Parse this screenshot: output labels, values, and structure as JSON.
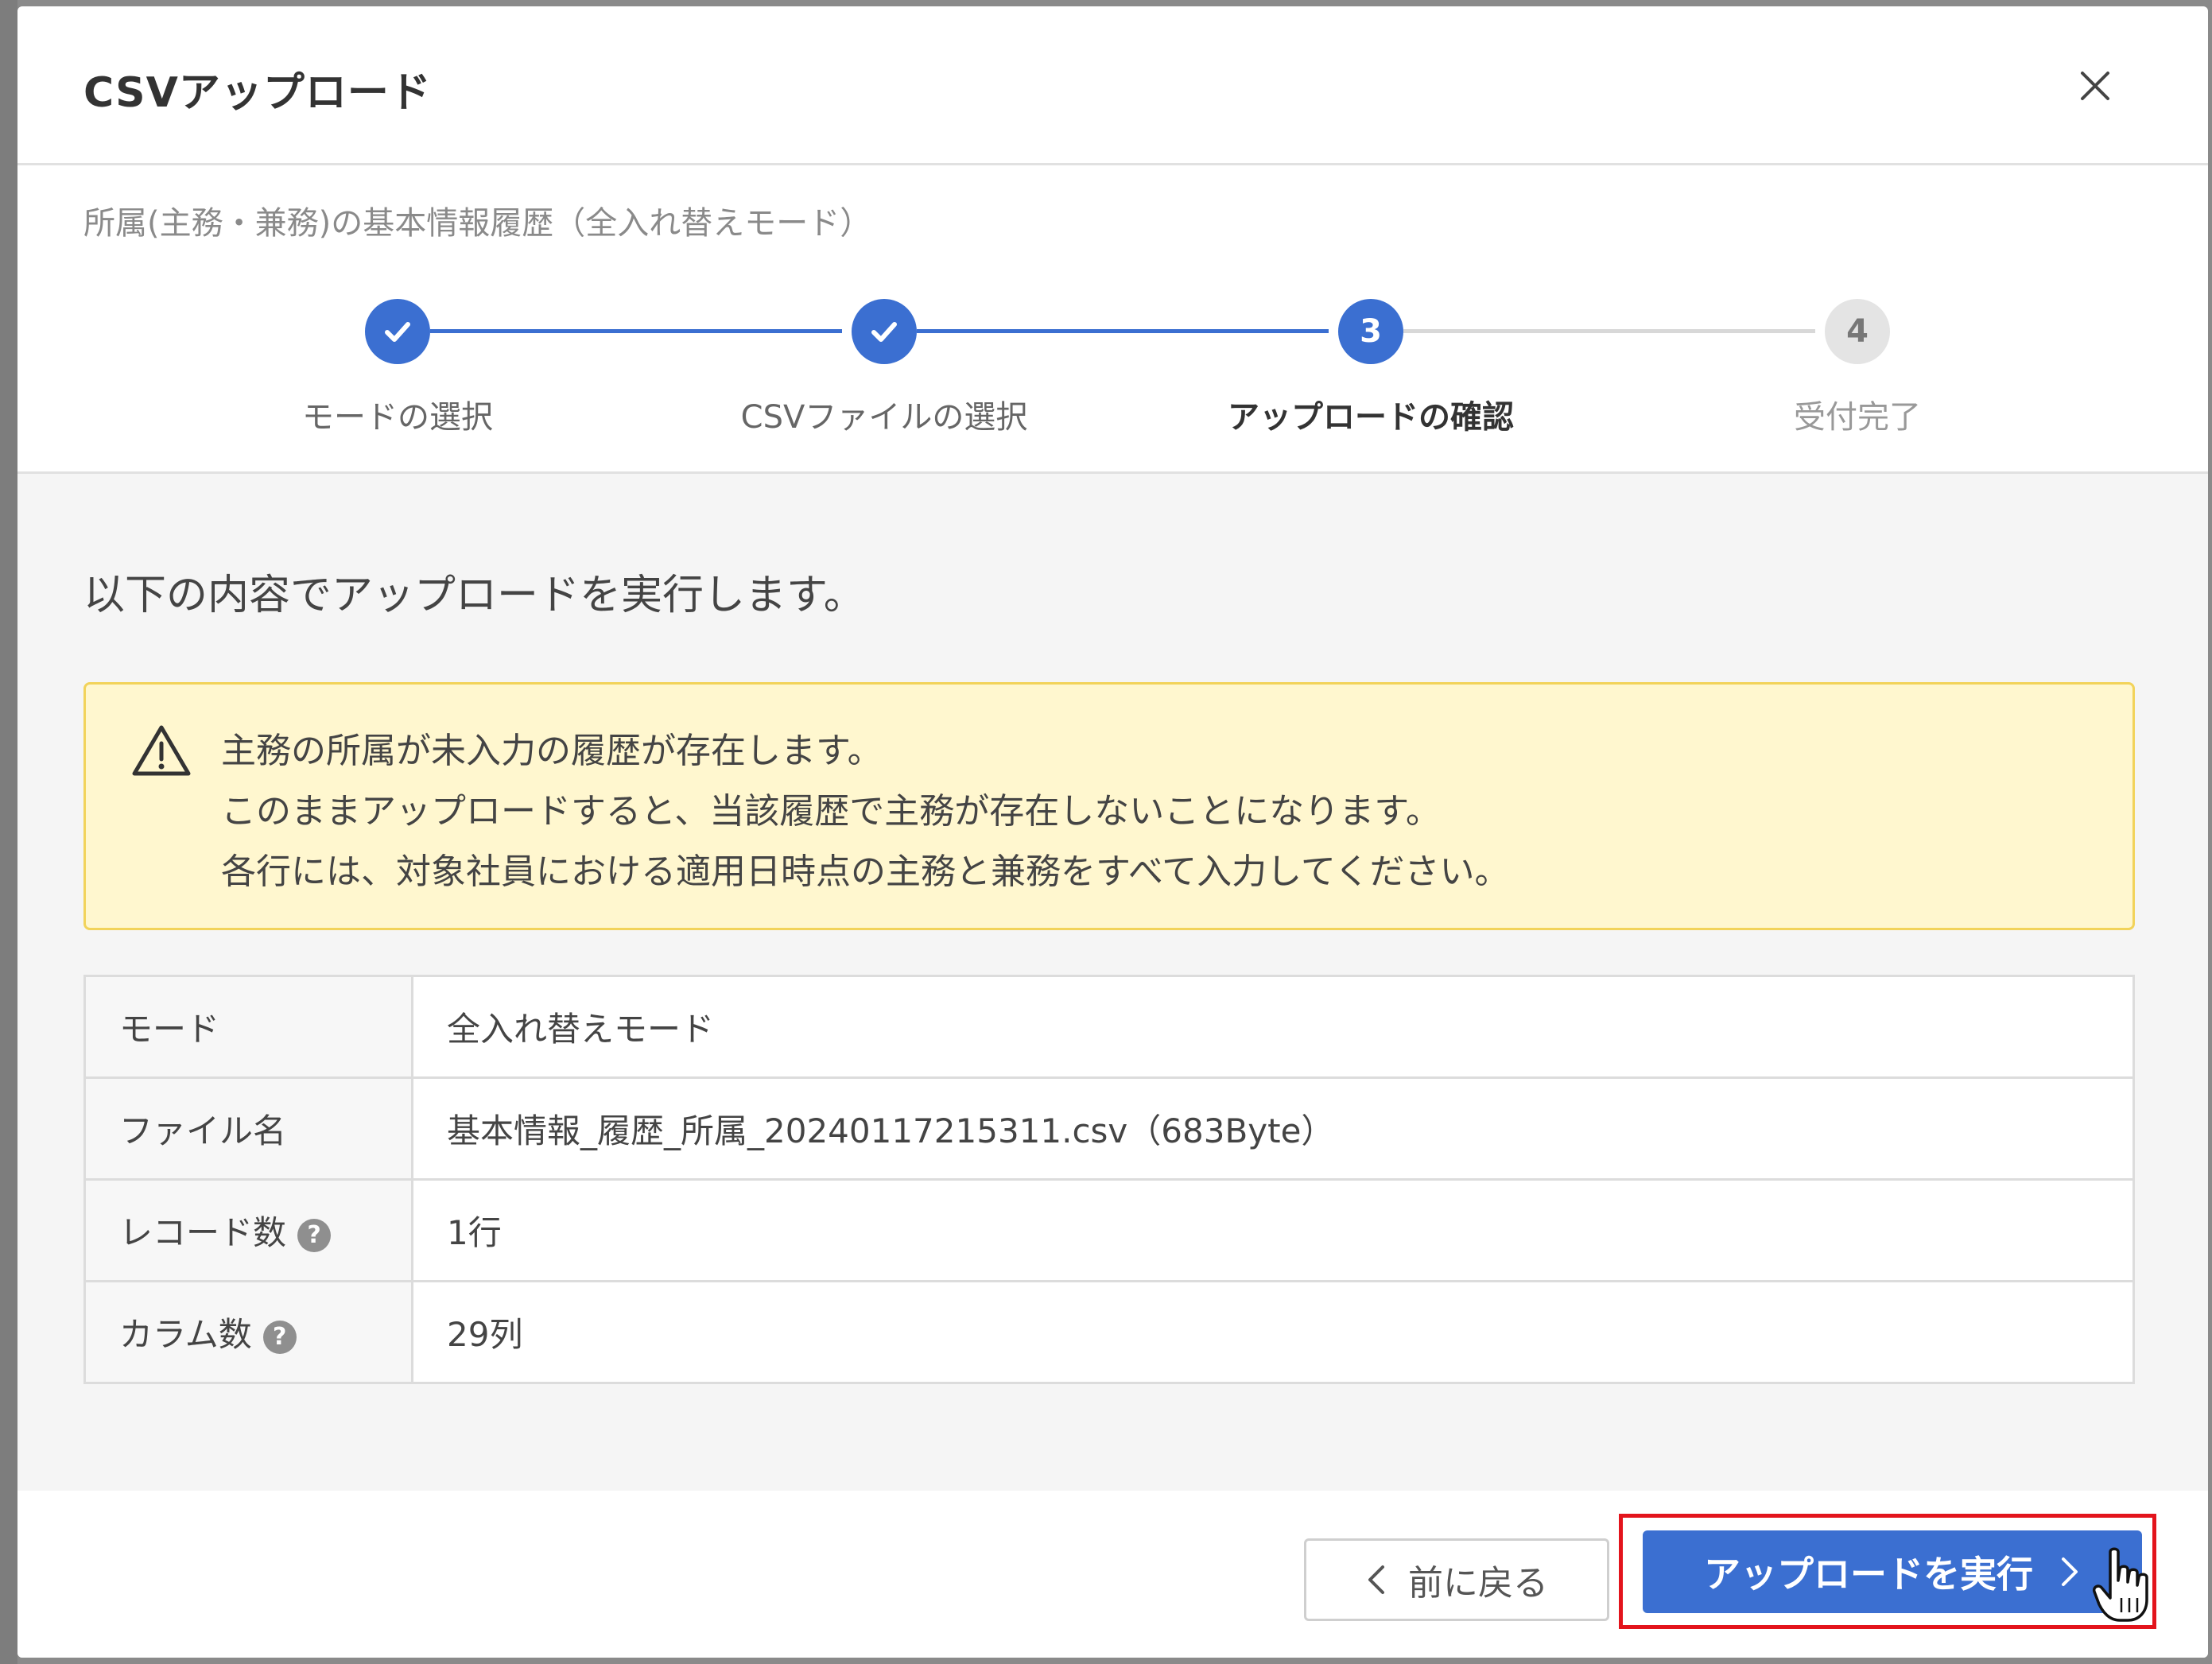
{
  "modal": {
    "title": "CSVアップロード",
    "subtitle": "所属(主務・兼務)の基本情報履歴（全入れ替えモード）"
  },
  "stepper": {
    "steps": [
      {
        "label": "モードの選択",
        "state": "done"
      },
      {
        "label": "CSVファイルの選択",
        "state": "done"
      },
      {
        "label": "アップロードの確認",
        "state": "current",
        "number": "3"
      },
      {
        "label": "受付完了",
        "state": "todo",
        "number": "4"
      }
    ]
  },
  "content": {
    "instruction": "以下の内容でアップロードを実行します。",
    "warning": {
      "icon": "warning-triangle-icon",
      "lines": [
        "主務の所属が未入力の履歴が存在します。",
        "このままアップロードすると、当該履歴で主務が存在しないことになります。",
        "各行には、対象社員における適用日時点の主務と兼務をすべて入力してください。"
      ]
    },
    "table": [
      {
        "key": "モード",
        "value": "全入れ替えモード"
      },
      {
        "key": "ファイル名",
        "value": "基本情報_履歴_所属_20240117215311.csv（683Byte）"
      },
      {
        "key": "レコード数",
        "value": "1行"
      },
      {
        "key": "カラム数",
        "value": "29列"
      }
    ]
  },
  "footer": {
    "back_label": "前に戻る",
    "execute_label": "アップロードを実行"
  },
  "colors": {
    "accent": "#3b6fd1",
    "warning_bg": "#fff7cf",
    "warning_border": "#f2d35a",
    "highlight": "#e3141c"
  }
}
